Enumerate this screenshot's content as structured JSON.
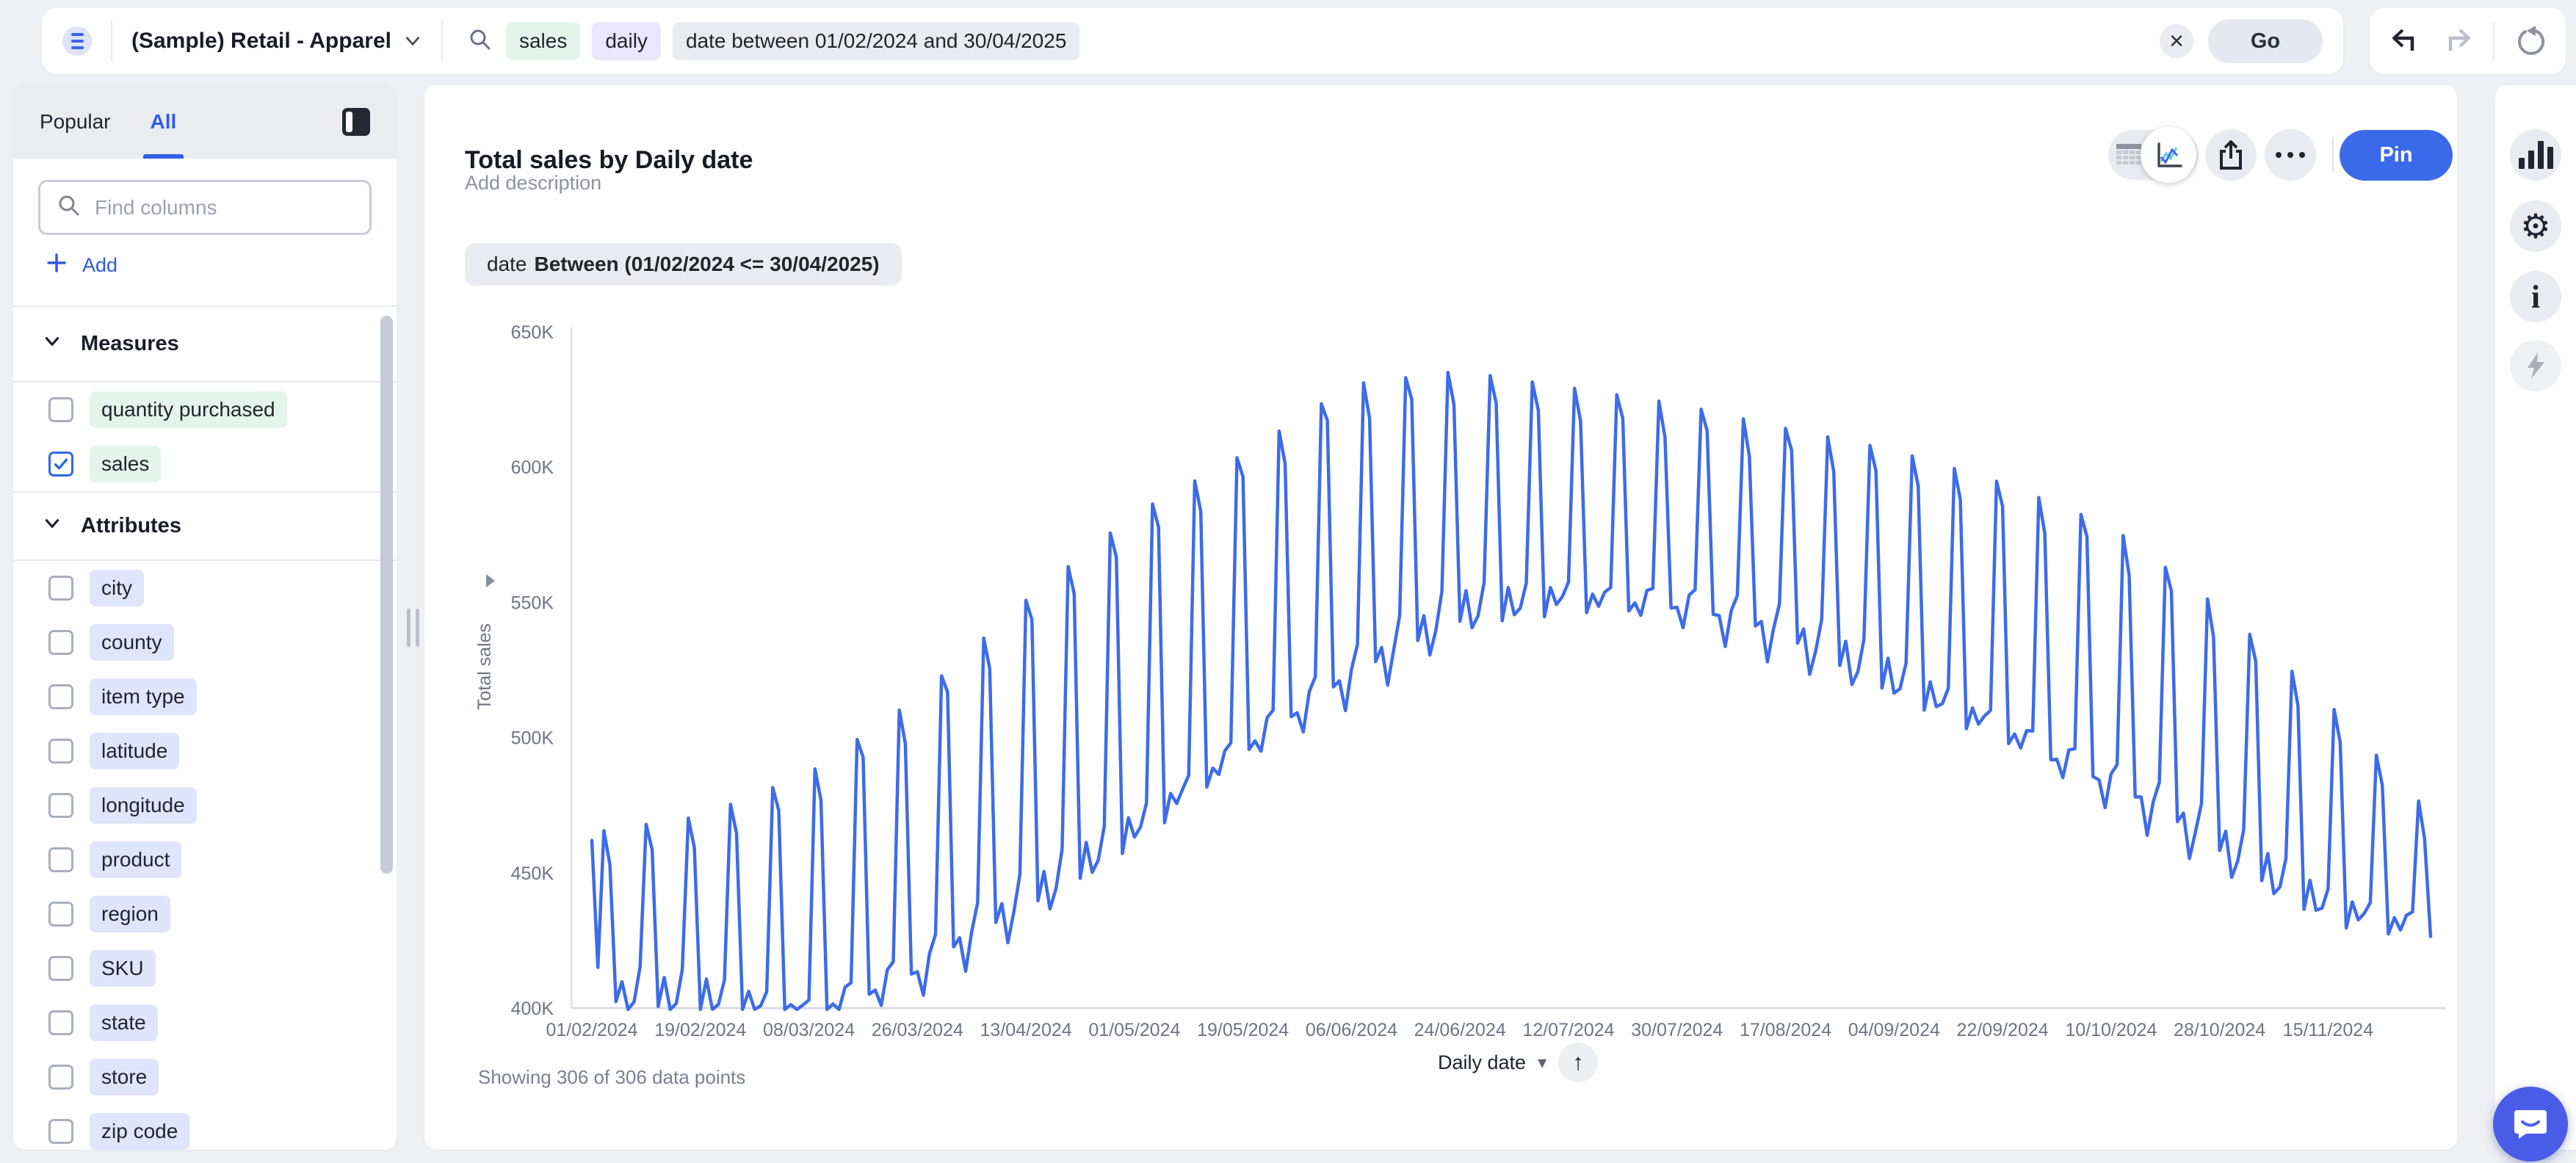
{
  "topbar": {
    "workspace": "(Sample) Retail - Apparel",
    "search_tokens": [
      {
        "text": "sales",
        "type": "measure"
      },
      {
        "text": "daily",
        "type": "keyword"
      },
      {
        "text": "date between 01/02/2024 and 30/04/2025",
        "type": "filter"
      }
    ],
    "clear_label": "×",
    "go_label": "Go"
  },
  "sidebar": {
    "tabs": [
      {
        "label": "Popular",
        "active": false
      },
      {
        "label": "All",
        "active": true
      }
    ],
    "search_placeholder": "Find columns",
    "add_label": "Add",
    "sections": [
      {
        "label": "Measures",
        "items": [
          {
            "label": "quantity purchased",
            "checked": false
          },
          {
            "label": "sales",
            "checked": true
          }
        ]
      },
      {
        "label": "Attributes",
        "items": [
          {
            "label": "city",
            "checked": false
          },
          {
            "label": "county",
            "checked": false
          },
          {
            "label": "item type",
            "checked": false
          },
          {
            "label": "latitude",
            "checked": false
          },
          {
            "label": "longitude",
            "checked": false
          },
          {
            "label": "product",
            "checked": false
          },
          {
            "label": "region",
            "checked": false
          },
          {
            "label": "SKU",
            "checked": false
          },
          {
            "label": "state",
            "checked": false
          },
          {
            "label": "store",
            "checked": false
          },
          {
            "label": "zip code",
            "checked": false
          }
        ]
      }
    ]
  },
  "main": {
    "title": "Total sales by Daily date",
    "description_placeholder": "Add description",
    "filter_chip": {
      "prefix": "date",
      "condition": "Between (01/02/2024 <= 30/04/2025)"
    },
    "pin_label": "Pin",
    "footer_status": "Showing 306 of 306 data points",
    "x_axis_control": {
      "label": "Daily date",
      "caret": "▾",
      "sort_glyph": "↑"
    }
  },
  "icons": {
    "topbar": [
      "hamburger-menu",
      "chevron-down",
      "search-magnifier",
      "close-x",
      "undo-arrow",
      "redo-arrow",
      "refresh-circular-arrow"
    ],
    "sidebar": [
      "panel-collapse",
      "search-magnifier",
      "plus",
      "chevron-down",
      "checkbox"
    ],
    "main_toolbar": [
      "table-grid",
      "line-chart",
      "share-upload",
      "ellipsis-more"
    ],
    "right_rail": [
      "bar-chart",
      "settings-gear",
      "info",
      "lightning-bolt"
    ],
    "chart": [
      "sort-triangle-right",
      "caret-down",
      "arrow-up"
    ],
    "floating": [
      "chat-bubble-smile"
    ]
  },
  "colors": {
    "accent_blue": "#2e5fe8",
    "pin_blue": "#3b6ae8",
    "line_blue": "#3e6ce8",
    "measure_green": "#e3f4ea",
    "attribute_lavender": "#dfe5fa",
    "keyword_purple": "#eae6fb",
    "chip_gray": "#e9ebf0",
    "chat_blue": "#4a5ce8"
  },
  "chart_data": {
    "type": "line",
    "title": "Total sales by Daily date",
    "xlabel": "Daily date",
    "ylabel": "Total sales",
    "legend": null,
    "grid": false,
    "line_color": "#3e6ce8",
    "ylim_k": [
      400,
      650
    ],
    "y_ticks": [
      "650K",
      "600K",
      "550K",
      "500K",
      "450K",
      "400K"
    ],
    "x_ticks": [
      "01/02/2024",
      "19/02/2024",
      "08/03/2024",
      "26/03/2024",
      "13/04/2024",
      "01/05/2024",
      "19/05/2024",
      "06/06/2024",
      "24/06/2024",
      "12/07/2024",
      "30/07/2024",
      "17/08/2024",
      "04/09/2024",
      "22/09/2024",
      "10/10/2024",
      "28/10/2024",
      "15/11/2024"
    ],
    "x_tick_interval_days": 18,
    "points_total": 306,
    "start_date": "01/02/2024",
    "start_weekday_index": 3,
    "first_point_k": 462,
    "weekday_offsets_k": [
      -2,
      4,
      -6,
      2,
      9,
      0,
      -8
    ],
    "weekend_sunday_drop_k": 8,
    "envelope_note": "daily series: weekday baseline 'low' with small offsets, weekend spike to 'high'; values in thousands read from axis",
    "envelope_points_k": [
      [
        0,
        402,
        462
      ],
      [
        18,
        404,
        468
      ],
      [
        36,
        398,
        484
      ],
      [
        54,
        412,
        512
      ],
      [
        72,
        438,
        548
      ],
      [
        90,
        466,
        580
      ],
      [
        108,
        496,
        602
      ],
      [
        126,
        521,
        628
      ],
      [
        144,
        546,
        633
      ],
      [
        162,
        552,
        627
      ],
      [
        180,
        548,
        621
      ],
      [
        198,
        536,
        612
      ],
      [
        216,
        521,
        604
      ],
      [
        234,
        503,
        592
      ],
      [
        252,
        481,
        576
      ],
      [
        270,
        459,
        546
      ],
      [
        288,
        437,
        511
      ],
      [
        305,
        429,
        470
      ]
    ]
  }
}
